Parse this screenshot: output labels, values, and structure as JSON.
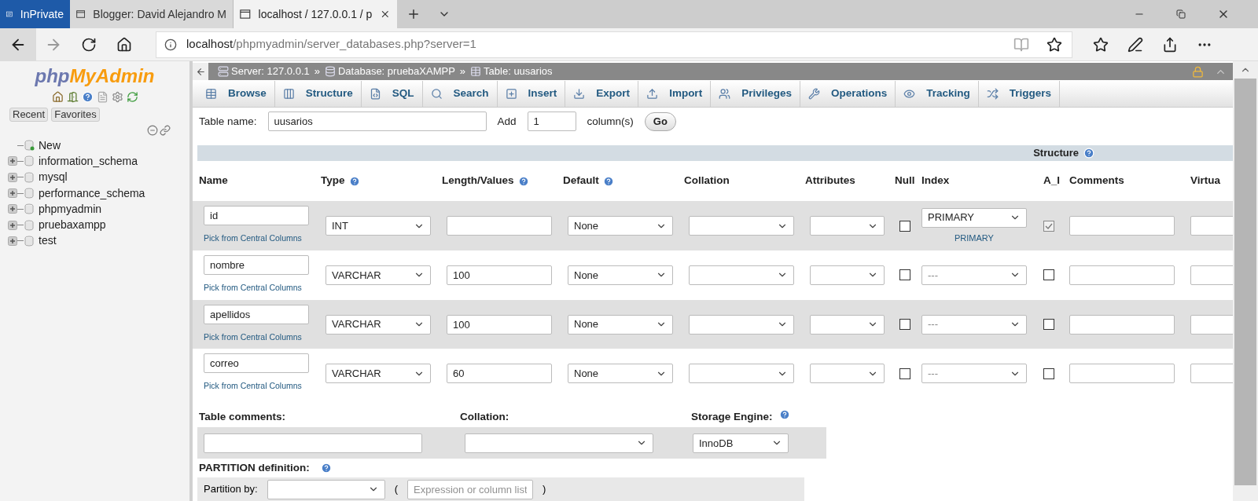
{
  "browser": {
    "tabs": [
      {
        "label": "InPrivate",
        "kind": "private",
        "selected": false
      },
      {
        "label": "Blogger: David Alejandro M",
        "kind": "page",
        "selected": false
      },
      {
        "label": "localhost / 127.0.0.1 / p",
        "kind": "page",
        "selected": true
      }
    ],
    "address": {
      "host": "localhost",
      "path": "/phpmyadmin/server_databases.php?server=1"
    }
  },
  "sidebar": {
    "logo": {
      "first": "php",
      "second": "MyAdmin"
    },
    "buttons": [
      "Recent",
      "Favorites"
    ],
    "tree": [
      {
        "label": "New",
        "kind": "new"
      },
      {
        "label": "information_schema",
        "kind": "db"
      },
      {
        "label": "mysql",
        "kind": "db"
      },
      {
        "label": "performance_schema",
        "kind": "db"
      },
      {
        "label": "phpmyadmin",
        "kind": "db"
      },
      {
        "label": "pruebaxampp",
        "kind": "db"
      },
      {
        "label": "test",
        "kind": "db"
      }
    ]
  },
  "breadcrumb": [
    {
      "label": "Server: 127.0.0.1",
      "kind": "server"
    },
    {
      "label": "Database: pruebaXAMPP",
      "kind": "database"
    },
    {
      "label": "Table: uusarios",
      "kind": "table"
    }
  ],
  "breadcrumb_separator": "»",
  "tabs": [
    {
      "label": "Browse",
      "kind": "browse"
    },
    {
      "label": "Structure",
      "kind": "structure"
    },
    {
      "label": "SQL",
      "kind": "sql"
    },
    {
      "label": "Search",
      "kind": "search"
    },
    {
      "label": "Insert",
      "kind": "insert"
    },
    {
      "label": "Export",
      "kind": "export"
    },
    {
      "label": "Import",
      "kind": "import"
    },
    {
      "label": "Privileges",
      "kind": "privileges"
    },
    {
      "label": "Operations",
      "kind": "operations"
    },
    {
      "label": "Tracking",
      "kind": "tracking"
    },
    {
      "label": "Triggers",
      "kind": "triggers"
    }
  ],
  "table_name": {
    "label": "Table name:",
    "value": "uusarios",
    "add_label": "Add",
    "add_count": "1",
    "add_suffix": "column(s)",
    "go": "Go"
  },
  "structure_label": "Structure",
  "columns": [
    {
      "label": "Name",
      "help": false
    },
    {
      "label": "Type",
      "help": true
    },
    {
      "label": "Length/Values",
      "help": true
    },
    {
      "label": "Default",
      "help": true
    },
    {
      "label": "Collation",
      "help": false
    },
    {
      "label": "Attributes",
      "help": false
    },
    {
      "label": "Null",
      "help": false
    },
    {
      "label": "Index",
      "help": false
    },
    {
      "label": "A_I",
      "help": false
    },
    {
      "label": "Comments",
      "help": false
    },
    {
      "label": "Virtua",
      "help": false
    }
  ],
  "rows": [
    {
      "name": "id",
      "pick": "Pick from Central Columns",
      "type": "INT",
      "length": "",
      "default": "None",
      "null": false,
      "index": "PRIMARY",
      "index_note": "PRIMARY",
      "ai": true
    },
    {
      "name": "nombre",
      "pick": "Pick from Central Columns",
      "type": "VARCHAR",
      "length": "100",
      "default": "None",
      "null": false,
      "index": "---",
      "ai": false
    },
    {
      "name": "apellidos",
      "pick": "Pick from Central Columns",
      "type": "VARCHAR",
      "length": "100",
      "default": "None",
      "null": false,
      "index": "---",
      "ai": false
    },
    {
      "name": "correo",
      "pick": "Pick from Central Columns",
      "type": "VARCHAR",
      "length": "60",
      "default": "None",
      "null": false,
      "index": "---",
      "ai": false
    }
  ],
  "footer": {
    "table_comments": "Table comments:",
    "collation": "Collation:",
    "storage_engine": "Storage Engine:",
    "engine": "InnoDB"
  },
  "partition": {
    "label": "PARTITION definition:",
    "by": "Partition by:",
    "open": "(",
    "placeholder": "Expression or column list",
    "close": ")"
  }
}
